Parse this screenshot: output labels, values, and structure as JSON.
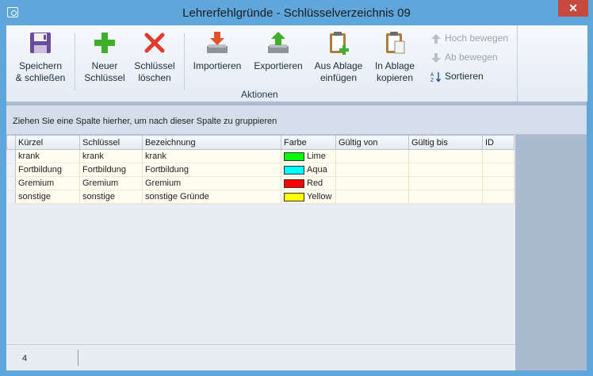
{
  "window": {
    "title": "Lehrerfehlgründe - Schlüsselverzeichnis 09",
    "close_glyph": "✕"
  },
  "toolbar": {
    "save_label_1": "Speichern",
    "save_label_2": "& schließen",
    "new_label_1": "Neuer",
    "new_label_2": "Schlüssel",
    "delete_label_1": "Schlüssel",
    "delete_label_2": "löschen",
    "import_label": "Importieren",
    "export_label": "Exportieren",
    "paste_label_1": "Aus Ablage",
    "paste_label_2": "einfügen",
    "copy_label_1": "In Ablage",
    "copy_label_2": "kopieren",
    "move_up_label": "Hoch bewegen",
    "move_down_label": "Ab bewegen",
    "sort_label": "Sortieren",
    "group_label": "Aktionen"
  },
  "grid": {
    "group_hint": "Ziehen Sie eine Spalte hierher, um nach dieser Spalte zu gruppieren",
    "columns": [
      "Kürzel",
      "Schlüssel",
      "Bezeichnung",
      "Farbe",
      "Gültig von",
      "Gültig bis",
      "ID"
    ],
    "rows": [
      {
        "kuerzel": "krank",
        "schluessel": "krank",
        "bezeichnung": "krank",
        "farbe": "Lime",
        "color": "#00ff00",
        "gueltig_von": "",
        "gueltig_bis": "",
        "id": ""
      },
      {
        "kuerzel": "Fortbildung",
        "schluessel": "Fortbildung",
        "bezeichnung": "Fortbildung",
        "farbe": "Aqua",
        "color": "#00ffff",
        "gueltig_von": "",
        "gueltig_bis": "",
        "id": ""
      },
      {
        "kuerzel": "Gremium",
        "schluessel": "Gremium",
        "bezeichnung": "Gremium",
        "farbe": "Red",
        "color": "#ff0000",
        "gueltig_von": "",
        "gueltig_bis": "",
        "id": ""
      },
      {
        "kuerzel": "sonstige",
        "schluessel": "sonstige",
        "bezeichnung": "sonstige Gründe",
        "farbe": "Yellow",
        "color": "#ffff00",
        "gueltig_von": "",
        "gueltig_bis": "",
        "id": ""
      }
    ]
  },
  "status": {
    "record_count": "4"
  },
  "colors": {
    "accent": "#5ea6dc",
    "close": "#c74a3e",
    "row_bg": "#fffdf0"
  }
}
